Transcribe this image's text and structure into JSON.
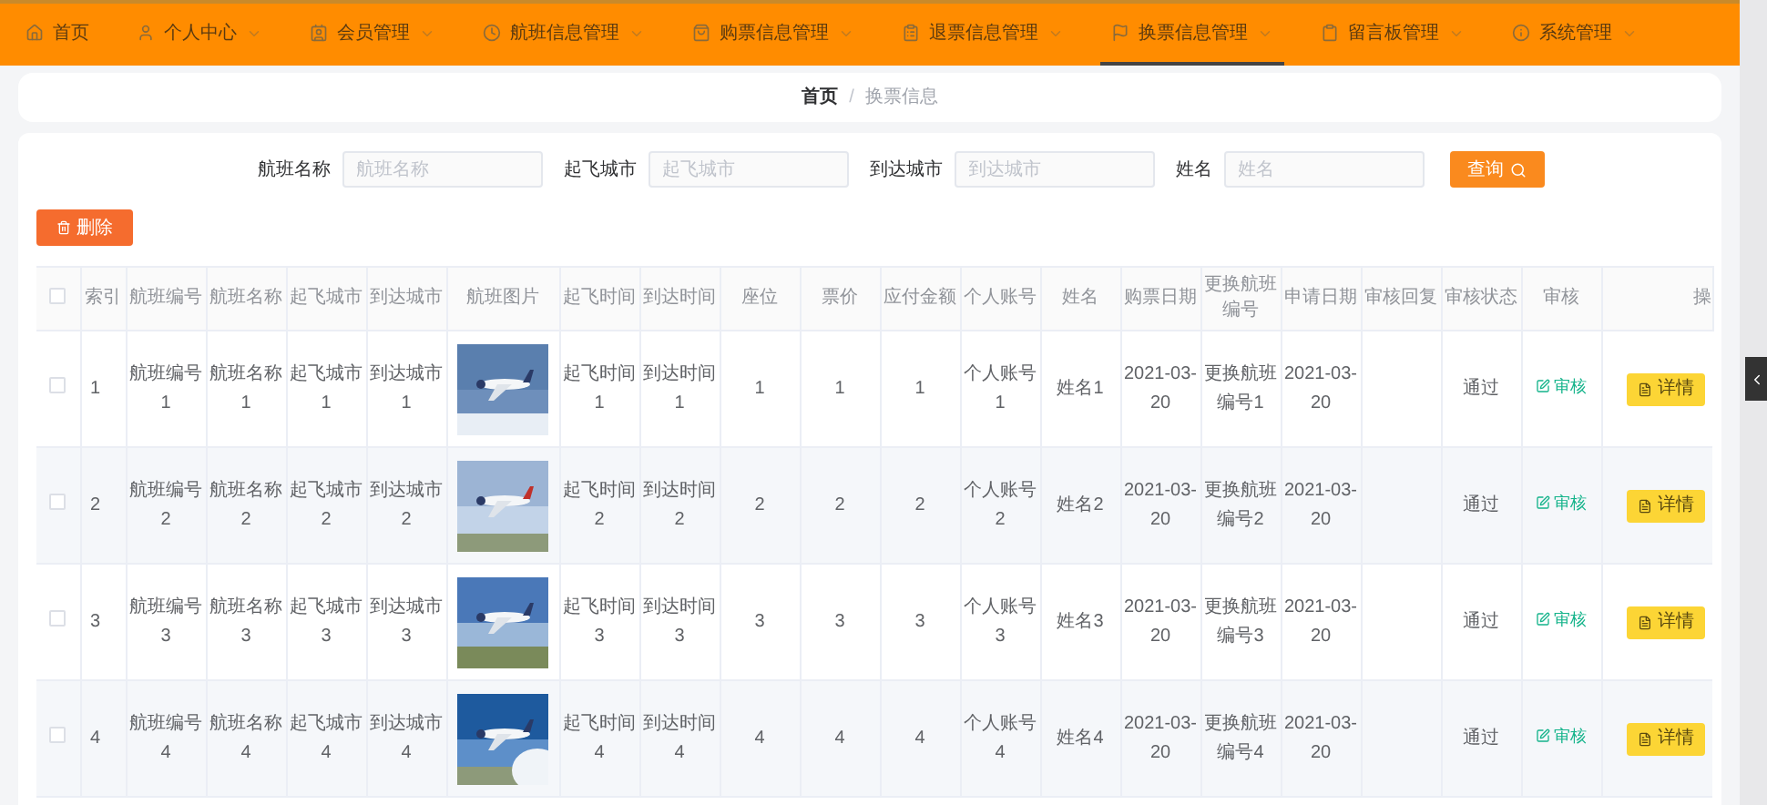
{
  "nav": [
    {
      "label": "首页",
      "selected": false,
      "dropdown": false
    },
    {
      "label": "个人中心",
      "selected": false,
      "dropdown": true
    },
    {
      "label": "会员管理",
      "selected": false,
      "dropdown": true
    },
    {
      "label": "航班信息管理",
      "selected": false,
      "dropdown": true
    },
    {
      "label": "购票信息管理",
      "selected": false,
      "dropdown": true
    },
    {
      "label": "退票信息管理",
      "selected": false,
      "dropdown": true
    },
    {
      "label": "换票信息管理",
      "selected": true,
      "dropdown": true
    },
    {
      "label": "留言板管理",
      "selected": false,
      "dropdown": true
    },
    {
      "label": "系统管理",
      "selected": false,
      "dropdown": true
    }
  ],
  "breadcrumb": {
    "home": "首页",
    "separator": "/",
    "current": "换票信息"
  },
  "search": {
    "fields": [
      {
        "label": "航班名称",
        "placeholder": "航班名称"
      },
      {
        "label": "起飞城市",
        "placeholder": "起飞城市"
      },
      {
        "label": "到达城市",
        "placeholder": "到达城市"
      },
      {
        "label": "姓名",
        "placeholder": "姓名"
      }
    ],
    "button": "查询"
  },
  "delete_button": "删除",
  "table": {
    "header_checked": false,
    "columns": [
      "索引",
      "航班编号",
      "航班名称",
      "起飞城市",
      "到达城市",
      "航班图片",
      "起飞时间",
      "到达时间",
      "座位",
      "票价",
      "应付金额",
      "个人账号",
      "姓名",
      "购票日期",
      "更换航班编号",
      "申请日期",
      "审核回复",
      "审核状态",
      "审核",
      "操"
    ],
    "rows": [
      {
        "checked": false,
        "index": "1",
        "flight_no": "航班编号1",
        "flight_name": "航班名称1",
        "from": "起飞城市1",
        "to": "到达城市1",
        "depart": "起飞时间1",
        "arrive": "到达时间1",
        "seat": "1",
        "price": "1",
        "amount": "1",
        "account": "个人账号1",
        "name": "姓名1",
        "buy_date": "2021-03-20",
        "new_flight": "更换航班编号1",
        "apply_date": "2021-03-20",
        "status": "通过",
        "review": "审核",
        "detail": "详情"
      },
      {
        "checked": false,
        "index": "2",
        "flight_no": "航班编号2",
        "flight_name": "航班名称2",
        "from": "起飞城市2",
        "to": "到达城市2",
        "depart": "起飞时间2",
        "arrive": "到达时间2",
        "seat": "2",
        "price": "2",
        "amount": "2",
        "account": "个人账号2",
        "name": "姓名2",
        "buy_date": "2021-03-20",
        "new_flight": "更换航班编号2",
        "apply_date": "2021-03-20",
        "status": "通过",
        "review": "审核",
        "detail": "详情"
      },
      {
        "checked": false,
        "index": "3",
        "flight_no": "航班编号3",
        "flight_name": "航班名称3",
        "from": "起飞城市3",
        "to": "到达城市3",
        "depart": "起飞时间3",
        "arrive": "到达时间3",
        "seat": "3",
        "price": "3",
        "amount": "3",
        "account": "个人账号3",
        "name": "姓名3",
        "buy_date": "2021-03-20",
        "new_flight": "更换航班编号3",
        "apply_date": "2021-03-20",
        "status": "通过",
        "review": "审核",
        "detail": "详情"
      },
      {
        "checked": false,
        "index": "4",
        "flight_no": "航班编号4",
        "flight_name": "航班名称4",
        "from": "起飞城市4",
        "to": "到达城市4",
        "depart": "起飞时间4",
        "arrive": "到达时间4",
        "seat": "4",
        "price": "4",
        "amount": "4",
        "account": "个人账号4",
        "name": "姓名4",
        "buy_date": "2021-03-20",
        "new_flight": "更换航班编号4",
        "apply_date": "2021-03-20",
        "status": "通过",
        "review": "审核",
        "detail": "详情"
      }
    ]
  }
}
